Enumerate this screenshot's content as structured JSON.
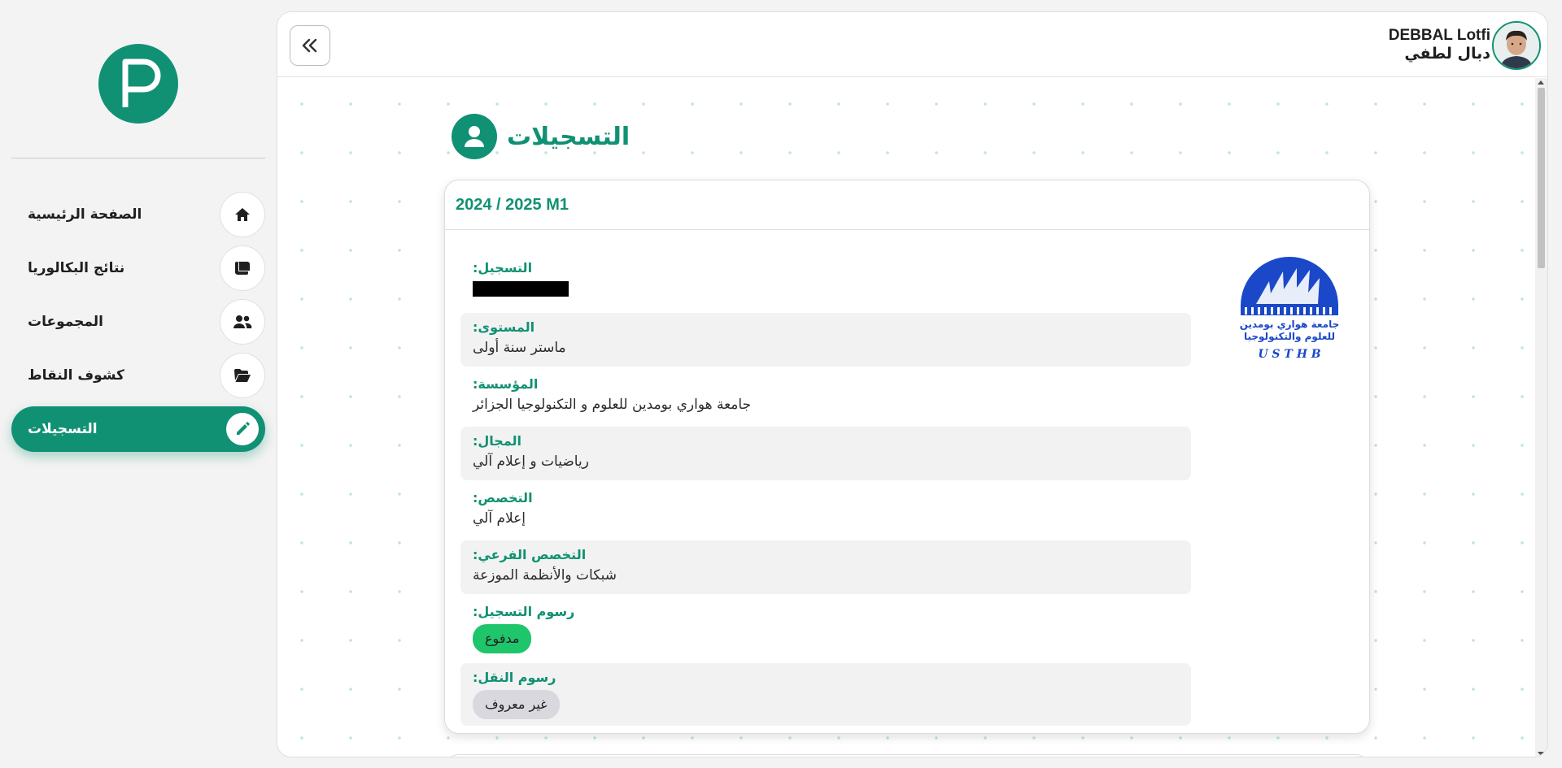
{
  "sidebar": {
    "logo_letter": "P",
    "items": [
      {
        "label": "الصفحة الرئيسية",
        "icon": "home-icon"
      },
      {
        "label": "نتائج البكالوريا",
        "icon": "scroll-icon"
      },
      {
        "label": "المجموعات",
        "icon": "users-icon"
      },
      {
        "label": "كشوف النقاط",
        "icon": "folder-open-icon"
      },
      {
        "label": "التسجيلات",
        "icon": "pencil-icon",
        "active": true
      }
    ]
  },
  "header": {
    "user_name": "DEBBAL Lotfi",
    "user_name_ar": "دبال لطفي"
  },
  "page": {
    "title": "التسجيلات"
  },
  "card": {
    "year_title": "2024 / 2025 M1",
    "fields": [
      {
        "label": "التسجيل:",
        "value": ""
      },
      {
        "label": "المستوى:",
        "value": "ماستر سنة أولى"
      },
      {
        "label": "المؤسسة:",
        "value": "جامعة هواري بومدين للعلوم و التكنولوجيا الجزائر"
      },
      {
        "label": "المجال:",
        "value": "رياضيات و إعلام آلي"
      },
      {
        "label": "التخصص:",
        "value": "إعلام آلي"
      },
      {
        "label": "التخصص الفرعي:",
        "value": "شبكات والأنظمة الموزعة"
      },
      {
        "label": "رسوم التسجيل:",
        "value": "مدفوع"
      },
      {
        "label": "رسوم النقل:",
        "value": "غير معروف"
      }
    ],
    "university_logo": {
      "arabic_text_1": "جامعة هواري بومدين",
      "arabic_text_2": "للعلوم والتكنولوجيا",
      "latin_text": "U S T H B"
    }
  },
  "colors": {
    "brand_green": "#109173",
    "paid_badge": "#1fc56b",
    "unknown_badge": "#d8d8de",
    "logo_blue": "#1a48c9"
  }
}
